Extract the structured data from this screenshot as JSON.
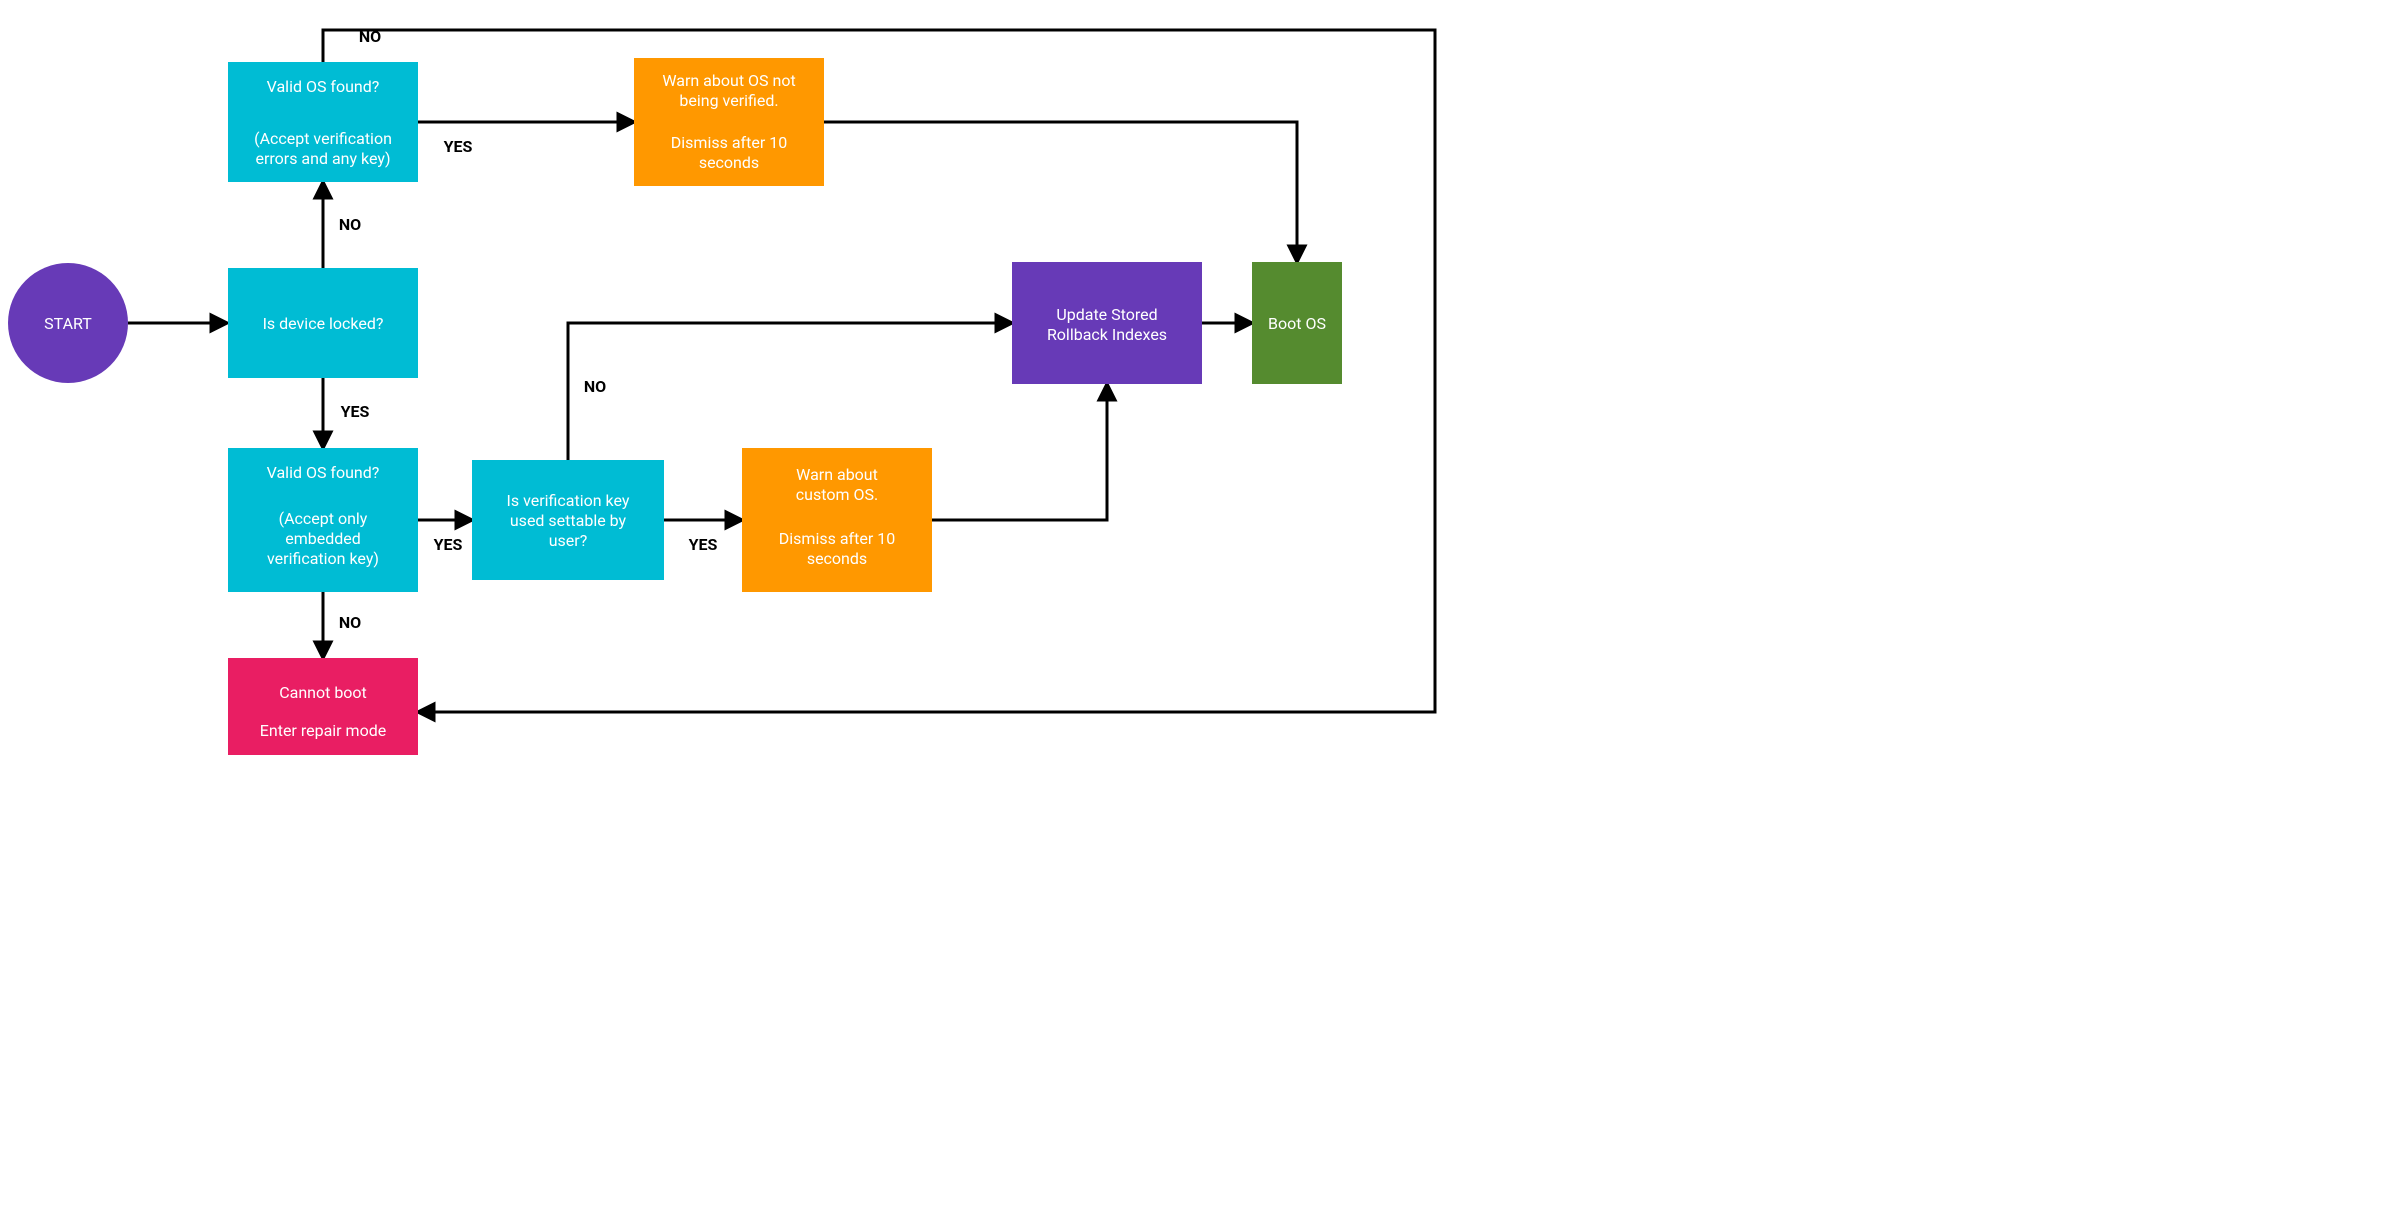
{
  "nodes": {
    "start": {
      "label": "START"
    },
    "valid_os_unlocked": {
      "line1": "Valid OS found?",
      "line2": "(Accept verification",
      "line3": "errors and any key)"
    },
    "device_locked": {
      "label": "Is device locked?"
    },
    "valid_os_locked": {
      "line1": "Valid OS found?",
      "line2": "(Accept only",
      "line3": "embedded",
      "line4": "verification key)"
    },
    "cannot_boot": {
      "line1": "Cannot boot",
      "line2": "Enter repair mode"
    },
    "warn_unverified": {
      "line1": "Warn about OS not",
      "line2": "being verified.",
      "line3": "Dismiss after 10",
      "line4": "seconds"
    },
    "key_settable": {
      "line1": "Is verification key",
      "line2": "used settable by",
      "line3": "user?"
    },
    "warn_custom": {
      "line1": "Warn about",
      "line2": "custom OS.",
      "line3": "Dismiss after 10",
      "line4": "seconds"
    },
    "update_rollback": {
      "line1": "Update Stored",
      "line2": "Rollback Indexes"
    },
    "boot_os": {
      "label": "Boot OS"
    }
  },
  "edges": {
    "no": "NO",
    "yes": "YES"
  },
  "colors": {
    "purple": "#673ab7",
    "cyan": "#00bcd4",
    "orange": "#ff9800",
    "green": "#558b2f",
    "pink": "#e91e63"
  }
}
